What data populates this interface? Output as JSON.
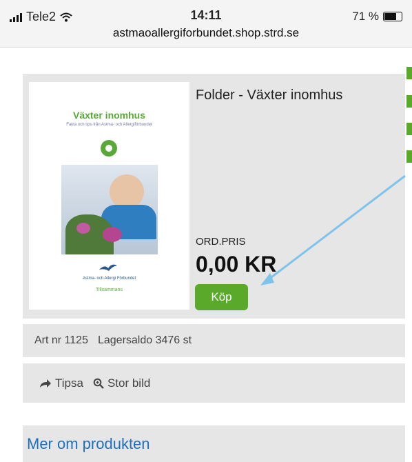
{
  "status": {
    "carrier": "Tele2",
    "time": "14:11",
    "battery": "71 %",
    "url": "astmaoallergiforbundet.shop.strd.se"
  },
  "product": {
    "title": "Folder - Växter inomhus",
    "cover": {
      "title": "Växter inomhus",
      "subtitle": "Fakta och tips från Astma- och Allergiförbundet",
      "org": "Astma- och Allergi Förbundet",
      "signature": "Tillsammans"
    },
    "price_label": "ORD.PRIS",
    "price": "0,00 KR",
    "buy_label": "Köp"
  },
  "info": {
    "art": "Art nr 1125",
    "stock": "Lagersaldo 3476 st"
  },
  "actions": {
    "tip": "Tipsa",
    "zoom": "Stor bild"
  },
  "more": "Mer om produkten",
  "colors": {
    "accent": "#5aa92b",
    "link": "#1e6fbf",
    "panel": "#e6e6e6",
    "arrow": "#7ec3ea"
  }
}
